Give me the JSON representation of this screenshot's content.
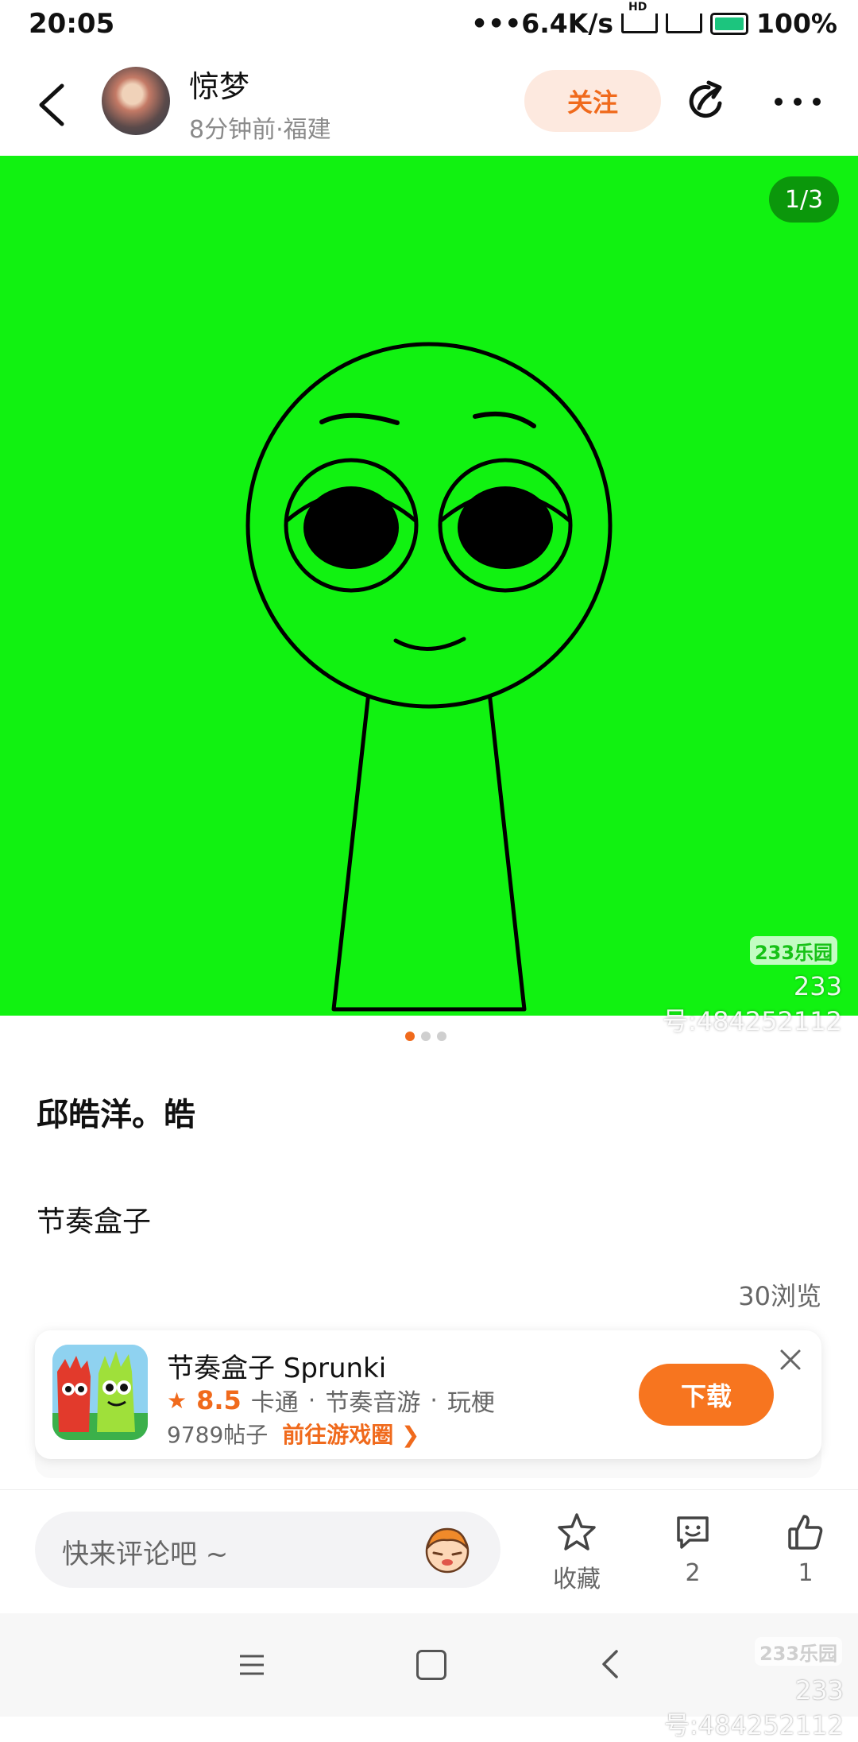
{
  "status_bar": {
    "time": "20:05",
    "network_speed": "•••6.4K/s",
    "hd_label": "HD",
    "battery": "100%"
  },
  "header": {
    "author_name": "惊梦",
    "post_meta": "8分钟前·福建",
    "follow_label": "关注"
  },
  "image": {
    "page_counter": "1/3",
    "watermark_logo": "233乐园",
    "watermark_id": "233号:484252112",
    "current_page": 1,
    "total_pages": 3
  },
  "post": {
    "title": "邱皓洋。皓",
    "body": "节奏盒子",
    "views": "30浏览"
  },
  "game_card": {
    "name": "节奏盒子 Sprunki",
    "rating": "8.5",
    "tags": [
      "卡通",
      "节奏音游",
      "玩梗"
    ],
    "separator": "·",
    "post_count": "9789帖子",
    "goto_label": "前往游戏圈",
    "download_label": "下载"
  },
  "bottom_bar": {
    "comment_placeholder": "快来评论吧 ~",
    "favorite_label": "收藏",
    "comment_count": "2",
    "like_count": "1"
  },
  "nav_watermark": {
    "logo": "233乐园",
    "id": "233号:484252112"
  },
  "colors": {
    "accent": "#f06a1c",
    "image_background": "#11f211",
    "follow_bg": "#fde9df"
  },
  "icons": [
    "back-arrow-icon",
    "share-icon",
    "more-icon",
    "star-icon",
    "comment-icon",
    "thumbs-up-icon",
    "close-icon",
    "chevron-right-icon",
    "nav-menu-icon",
    "nav-home-icon",
    "nav-back-icon"
  ]
}
